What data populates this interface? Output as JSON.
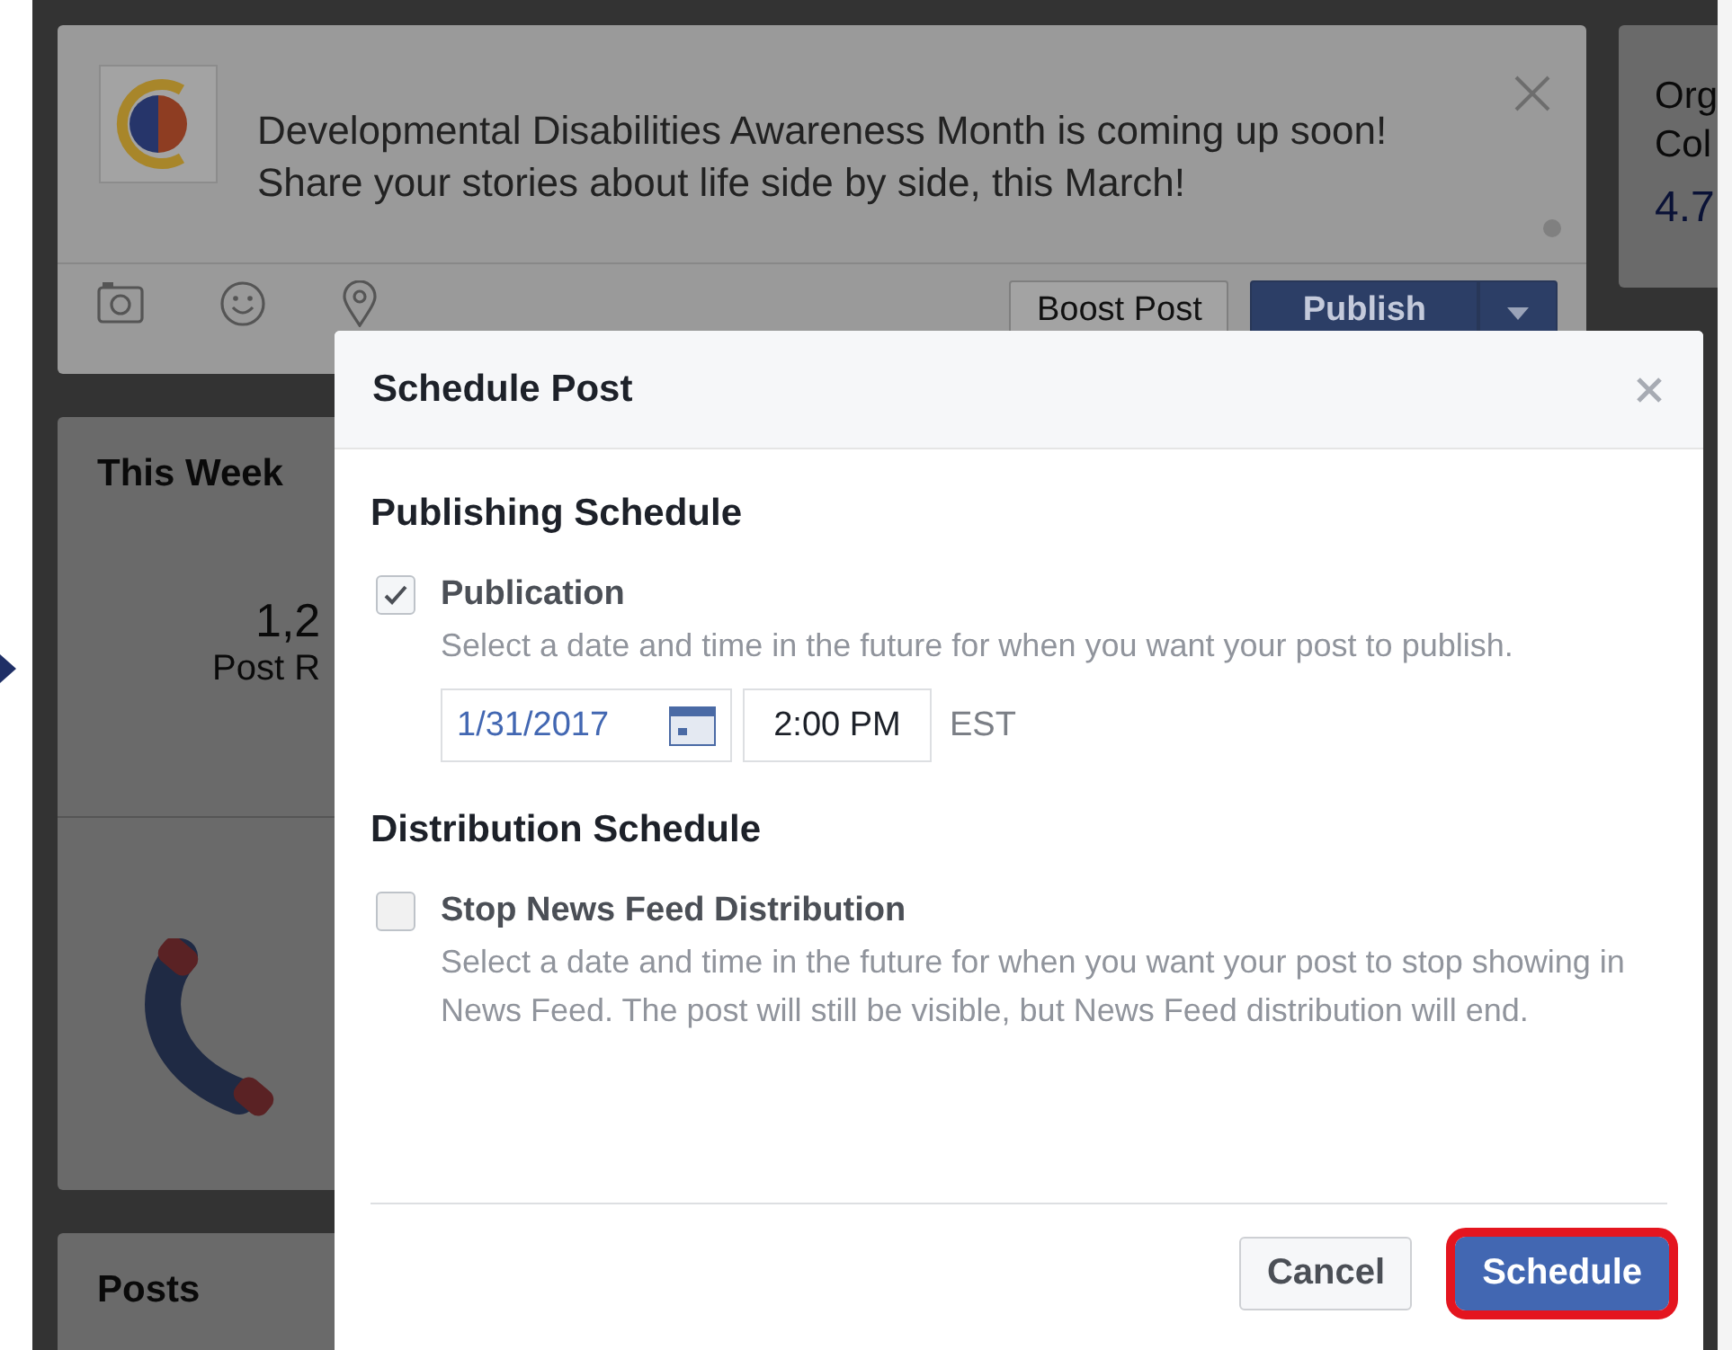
{
  "background_page": {
    "composer": {
      "message_lines": [
        "Developmental Disabilities Awareness Month is coming up soon!",
        "Share your stories about life side by side, this March!"
      ],
      "boost_button": "Boost Post",
      "publish_button": "Publish"
    },
    "this_week": {
      "title": "This Week",
      "stat_value": "1,2",
      "stat_label": "Post R"
    },
    "posts": {
      "title": "Posts"
    },
    "side_card": {
      "lines": [
        "Org",
        "Col"
      ],
      "rating": "4.7"
    }
  },
  "dialog": {
    "title": "Schedule Post",
    "sections": [
      {
        "heading": "Publishing Schedule",
        "option": {
          "label": "Publication",
          "checked": true,
          "description": "Select a date and time in the future for when you want your post to publish."
        },
        "schedule": {
          "date": "1/31/2017",
          "time": "2:00 PM",
          "timezone": "EST"
        }
      },
      {
        "heading": "Distribution Schedule",
        "option": {
          "label": "Stop News Feed Distribution",
          "checked": false,
          "description": "Select a date and time in the future for when you want your post to stop showing in News Feed. The post will still be visible, but News Feed distribution will end."
        }
      }
    ],
    "buttons": [
      {
        "label": "Cancel",
        "kind": "secondary",
        "highlighted": false
      },
      {
        "label": "Schedule",
        "kind": "primary",
        "highlighted": true
      }
    ]
  }
}
